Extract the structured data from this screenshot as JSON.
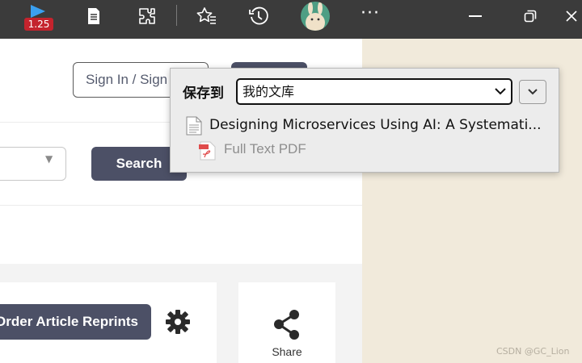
{
  "toolbar": {
    "zoom_badge": "1.25",
    "icons": [
      "media-play-icon",
      "reading-list-icon",
      "extensions-icon",
      "favorites-icon",
      "history-icon",
      "profile-avatar",
      "more-icon",
      "minimize-icon",
      "restore-icon",
      "close-icon"
    ],
    "more_label": "···"
  },
  "page": {
    "signin_label": "Sign In / Sign Up",
    "search_label": "Search",
    "reprint_label": "Order Article Reprints",
    "share_label": "Share"
  },
  "popup": {
    "save_to_label": "保存到",
    "collection_value": "我的文库",
    "item_title": "Designing Microservices Using AI: A Systematic Literature Review",
    "item_title_display": "Designing Microservices Using AI: A Systemati...",
    "attachment_label": "Full Text PDF"
  },
  "watermark": "CSDN @GC_Lion",
  "colors": {
    "toolbar_bg": "#3b3b3b",
    "button_bg": "#4c5066",
    "side_panel_bg": "#f1eadb",
    "popup_bg": "#ececec",
    "zoom_badge_bg": "#c4232d"
  }
}
